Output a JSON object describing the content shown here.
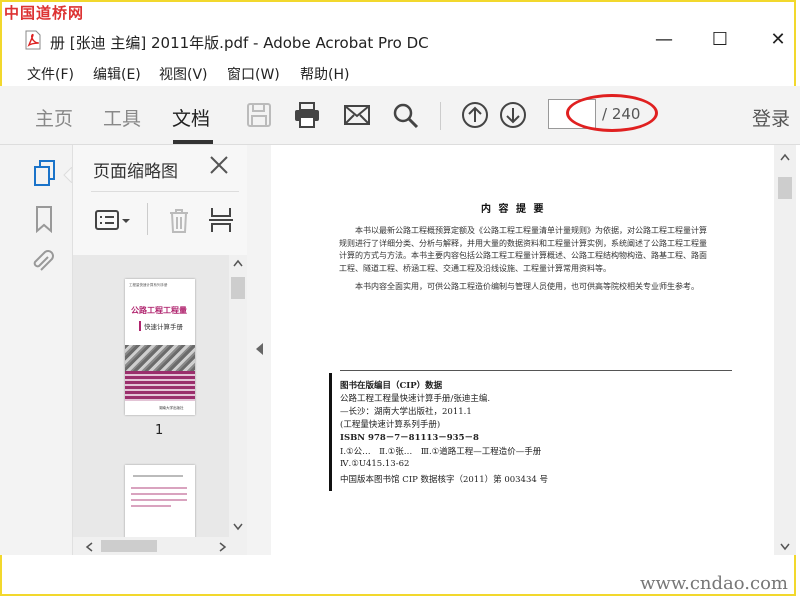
{
  "watermark": {
    "top": "中国道桥网",
    "bottom": "www.cndao.com"
  },
  "window": {
    "title": "册 [张迪 主编] 2011年版.pdf - Adobe Acrobat Pro DC",
    "min": "—",
    "max": "☐",
    "close": "✕"
  },
  "menu": [
    "文件(F)",
    "编辑(E)",
    "视图(V)",
    "窗口(W)",
    "帮助(H)"
  ],
  "tabs": {
    "home": "主页",
    "tools": "工具",
    "document": "文档"
  },
  "toolbar": {
    "page_count": "/ 240",
    "login": "登录"
  },
  "panel": {
    "title": "页面缩略图"
  },
  "thumbs": {
    "page1_number": "1",
    "cover_series": "工程量快速计算系列手册",
    "cover_title": "公路工程工程量",
    "cover_subtitle": "快速计算手册",
    "cover_publisher": "湖南大学出版社"
  },
  "document": {
    "summary_title": "内 容 提 要",
    "para1": "本书以最新公路工程概预算定额及《公路工程工程量清单计量规则》为依据，对公路工程工程量计算规则进行了详细分类、分析与解释，并用大量的数据资料和工程量计算实例，系统阐述了公路工程工程量计算的方式与方法。本书主要内容包括公路工程工程量计算概述、公路工程结构物构造、路基工程、路面工程、隧道工程、桥涵工程、交通工程及沿线设施、工程量计算常用资料等。",
    "para2": "本书内容全面实用，可供公路工程造价编制与管理人员使用，也可供高等院校相关专业师生参考。",
    "cip": [
      "图书在版编目（CIP）数据",
      "公路工程工程量快速计算手册/张迪主编.",
      "—长沙：湖南大学出版社，2011.1",
      "(工程量快速计算系列手册)",
      "ISBN 978－7－81113－935－8",
      "Ⅰ.①公…　Ⅱ.①张…　Ⅲ.①道路工程—工程造价—手册",
      "Ⅳ.①U415.13-62",
      "中国版本图书馆 CIP 数据核字（2011）第 003434 号"
    ]
  }
}
